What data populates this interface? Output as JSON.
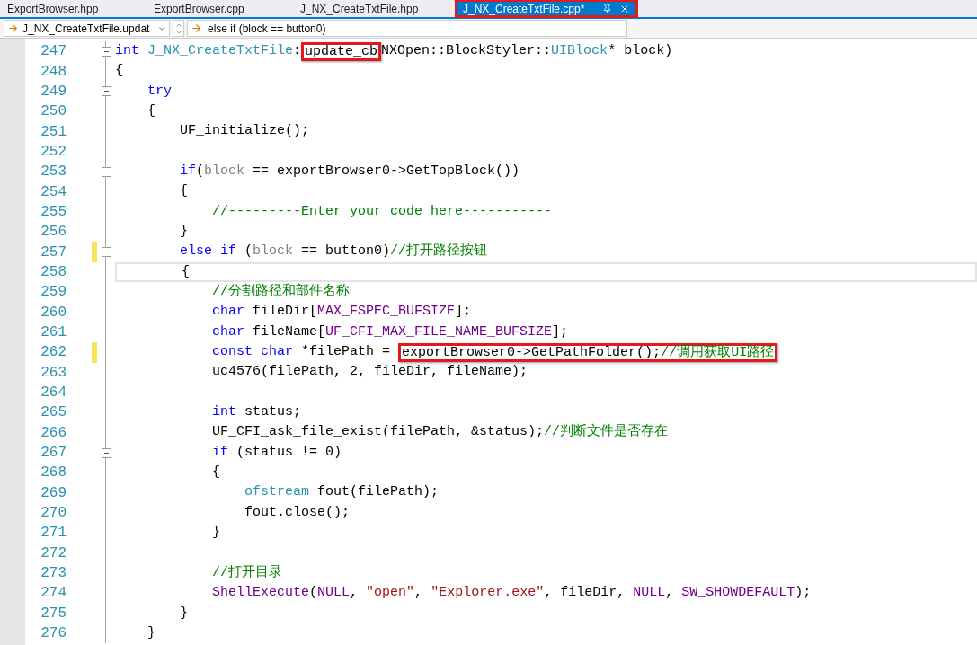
{
  "tabs": [
    {
      "label": "ExportBrowser.hpp",
      "selected": false,
      "annotated": false
    },
    {
      "label": "ExportBrowser.cpp",
      "selected": false,
      "annotated": false
    },
    {
      "label": "J_NX_CreateTxtFile.hpp",
      "selected": false,
      "annotated": false
    },
    {
      "label": "J_NX_CreateTxtFile.cpp*",
      "selected": true,
      "annotated": true
    }
  ],
  "navigation_bar": {
    "scope": "J_NX_CreateTxtFile.updat",
    "member": "else if (block == button0)"
  },
  "lines": [
    {
      "number": "247",
      "fold": true,
      "changed": false,
      "current": false,
      "tokens": [
        {
          "kind": "kw",
          "text": "int"
        },
        {
          "kind": "type",
          "text": " J_NX_CreateTxtFile"
        },
        {
          "kind": "plain",
          "text": ":"
        },
        {
          "kind": "boxed",
          "tokens": [
            {
              "kind": "plain",
              "text": "update_cb"
            }
          ]
        },
        {
          "kind": "plain",
          "text": "NXOpen::BlockStyler::"
        },
        {
          "kind": "type",
          "text": "UIBlock"
        },
        {
          "kind": "plain",
          "text": "* block)"
        }
      ]
    },
    {
      "number": "248",
      "fold": false,
      "changed": false,
      "current": false,
      "tokens": [
        {
          "kind": "plain",
          "text": "{"
        }
      ]
    },
    {
      "number": "249",
      "fold": true,
      "changed": false,
      "current": false,
      "tokens": [
        {
          "kind": "kw",
          "text": "    try"
        }
      ]
    },
    {
      "number": "250",
      "fold": false,
      "changed": false,
      "current": false,
      "tokens": [
        {
          "kind": "plain",
          "text": "    {"
        }
      ]
    },
    {
      "number": "251",
      "fold": false,
      "changed": false,
      "current": false,
      "tokens": [
        {
          "kind": "plain",
          "text": "        UF_initialize();"
        }
      ]
    },
    {
      "number": "252",
      "fold": false,
      "changed": false,
      "current": false
    },
    {
      "number": "253",
      "fold": true,
      "changed": false,
      "current": false,
      "tokens": [
        {
          "kind": "kw",
          "text": "        if"
        },
        {
          "kind": "plain",
          "text": "("
        },
        {
          "kind": "param",
          "text": "block"
        },
        {
          "kind": "plain",
          "text": " == exportBrowser0->GetTopBlock())"
        }
      ]
    },
    {
      "number": "254",
      "fold": false,
      "changed": false,
      "current": false,
      "tokens": [
        {
          "kind": "plain",
          "text": "        {"
        }
      ]
    },
    {
      "number": "255",
      "fold": false,
      "changed": false,
      "current": false,
      "tokens": [
        {
          "kind": "comment",
          "text": "            //---------Enter your code here-----------"
        }
      ]
    },
    {
      "number": "256",
      "fold": false,
      "changed": false,
      "current": false,
      "tokens": [
        {
          "kind": "plain",
          "text": "        }"
        }
      ]
    },
    {
      "number": "257",
      "fold": true,
      "changed": true,
      "current": false,
      "tokens": [
        {
          "kind": "kw",
          "text": "        else if"
        },
        {
          "kind": "plain",
          "text": " ("
        },
        {
          "kind": "param",
          "text": "block"
        },
        {
          "kind": "plain",
          "text": " == button0)"
        },
        {
          "kind": "comment",
          "text": "//打开路径按钮"
        }
      ]
    },
    {
      "number": "258",
      "fold": false,
      "changed": false,
      "current": true,
      "tokens": [
        {
          "kind": "plain",
          "text": "        {"
        }
      ]
    },
    {
      "number": "259",
      "fold": false,
      "changed": false,
      "current": false,
      "tokens": [
        {
          "kind": "comment",
          "text": "            //分割路径和部件名称"
        }
      ]
    },
    {
      "number": "260",
      "fold": false,
      "changed": false,
      "current": false,
      "tokens": [
        {
          "kind": "kw",
          "text": "            char"
        },
        {
          "kind": "plain",
          "text": " fileDir["
        },
        {
          "kind": "macro",
          "text": "MAX_FSPEC_BUFSIZE"
        },
        {
          "kind": "plain",
          "text": "];"
        }
      ]
    },
    {
      "number": "261",
      "fold": false,
      "changed": false,
      "current": false,
      "tokens": [
        {
          "kind": "kw",
          "text": "            char"
        },
        {
          "kind": "plain",
          "text": " fileName["
        },
        {
          "kind": "macro",
          "text": "UF_CFI_MAX_FILE_NAME_BUFSIZE"
        },
        {
          "kind": "plain",
          "text": "];"
        }
      ]
    },
    {
      "number": "262",
      "fold": false,
      "changed": true,
      "current": false,
      "tokens": [
        {
          "kind": "kw",
          "text": "            const char"
        },
        {
          "kind": "plain",
          "text": " *filePath = "
        },
        {
          "kind": "boxed",
          "tokens": [
            {
              "kind": "plain",
              "text": "exportBrowser0->GetPathFolder();"
            },
            {
              "kind": "comment",
              "text": "//调用获取UI路径"
            }
          ]
        }
      ]
    },
    {
      "number": "263",
      "fold": false,
      "changed": false,
      "current": false,
      "tokens": [
        {
          "kind": "plain",
          "text": "            uc4576(filePath, 2, fileDir, fileName);"
        }
      ]
    },
    {
      "number": "264",
      "fold": false,
      "changed": false,
      "current": false
    },
    {
      "number": "265",
      "fold": false,
      "changed": false,
      "current": false,
      "tokens": [
        {
          "kind": "kw",
          "text": "            int"
        },
        {
          "kind": "plain",
          "text": " status;"
        }
      ]
    },
    {
      "number": "266",
      "fold": false,
      "changed": false,
      "current": false,
      "tokens": [
        {
          "kind": "plain",
          "text": "            UF_CFI_ask_file_exist(filePath, &status);"
        },
        {
          "kind": "comment",
          "text": "//判断文件是否存在"
        }
      ]
    },
    {
      "number": "267",
      "fold": true,
      "changed": false,
      "current": false,
      "tokens": [
        {
          "kind": "kw",
          "text": "            if"
        },
        {
          "kind": "plain",
          "text": " (status != 0)"
        }
      ]
    },
    {
      "number": "268",
      "fold": false,
      "changed": false,
      "current": false,
      "tokens": [
        {
          "kind": "plain",
          "text": "            {"
        }
      ]
    },
    {
      "number": "269",
      "fold": false,
      "changed": false,
      "current": false,
      "tokens": [
        {
          "kind": "type",
          "text": "                ofstream"
        },
        {
          "kind": "plain",
          "text": " fout(filePath);"
        }
      ]
    },
    {
      "number": "270",
      "fold": false,
      "changed": false,
      "current": false,
      "tokens": [
        {
          "kind": "plain",
          "text": "                fout.close();"
        }
      ]
    },
    {
      "number": "271",
      "fold": false,
      "changed": false,
      "current": false,
      "tokens": [
        {
          "kind": "plain",
          "text": "            }"
        }
      ]
    },
    {
      "number": "272",
      "fold": false,
      "changed": false,
      "current": false
    },
    {
      "number": "273",
      "fold": false,
      "changed": false,
      "current": false,
      "tokens": [
        {
          "kind": "comment",
          "text": "            //打开目录"
        }
      ]
    },
    {
      "number": "274",
      "fold": false,
      "changed": false,
      "current": false,
      "tokens": [
        {
          "kind": "macro",
          "text": "            ShellExecute"
        },
        {
          "kind": "plain",
          "text": "("
        },
        {
          "kind": "macro",
          "text": "NULL"
        },
        {
          "kind": "plain",
          "text": ", "
        },
        {
          "kind": "string",
          "text": "\"open\""
        },
        {
          "kind": "plain",
          "text": ", "
        },
        {
          "kind": "string",
          "text": "\"Explorer.exe\""
        },
        {
          "kind": "plain",
          "text": ", fileDir, "
        },
        {
          "kind": "macro",
          "text": "NULL"
        },
        {
          "kind": "plain",
          "text": ", "
        },
        {
          "kind": "macro",
          "text": "SW_SHOWDEFAULT"
        },
        {
          "kind": "plain",
          "text": ");"
        }
      ]
    },
    {
      "number": "275",
      "fold": false,
      "changed": false,
      "current": false,
      "tokens": [
        {
          "kind": "plain",
          "text": "        }"
        }
      ]
    },
    {
      "number": "276",
      "fold": false,
      "changed": false,
      "current": false,
      "tokens": [
        {
          "kind": "plain",
          "text": "    }"
        }
      ]
    }
  ]
}
